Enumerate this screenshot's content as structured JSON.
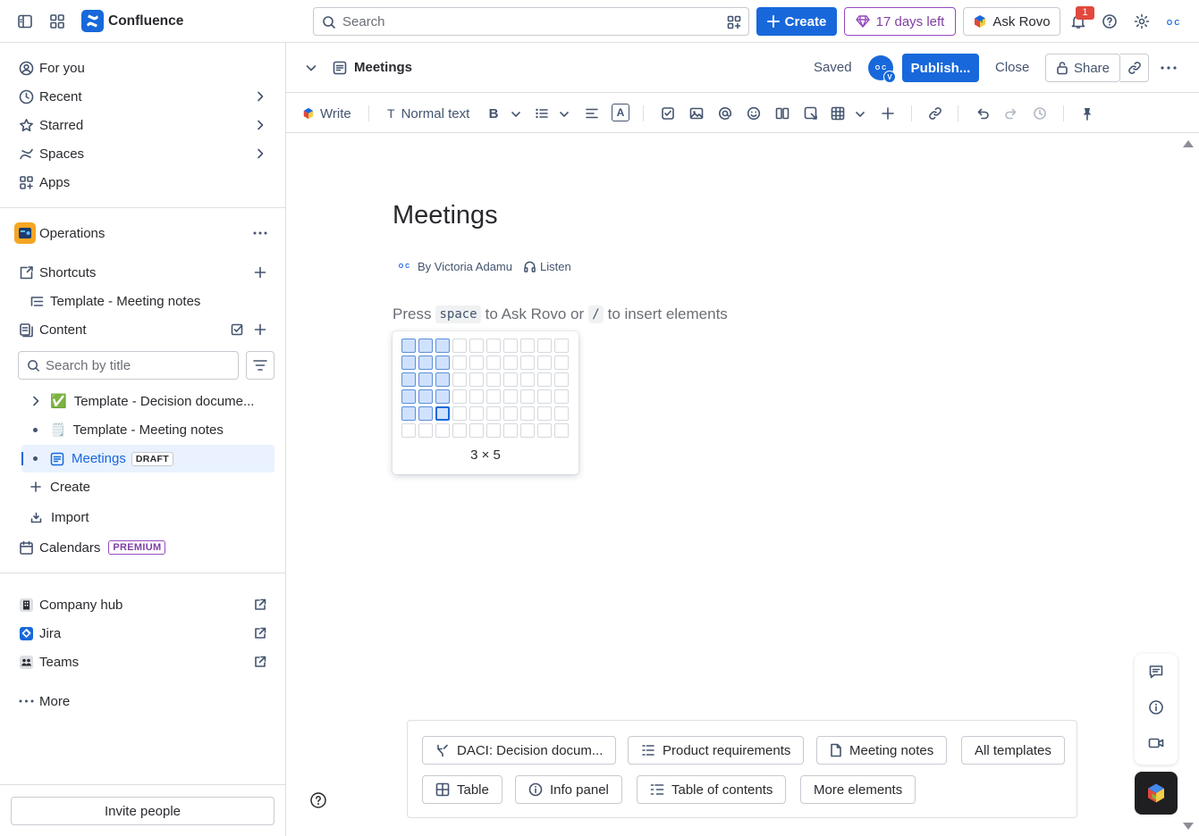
{
  "topbar": {
    "app_name": "Confluence",
    "search_placeholder": "Search",
    "create_label": "Create",
    "trial_label": "17 days left",
    "rovo_label": "Ask Rovo",
    "notifications_count": "1",
    "profile_initials": "O C"
  },
  "sidebar": {
    "nav": [
      {
        "label": "For you"
      },
      {
        "label": "Recent"
      },
      {
        "label": "Starred"
      },
      {
        "label": "Spaces"
      },
      {
        "label": "Apps"
      }
    ],
    "space_name": "Operations",
    "shortcuts_label": "Shortcuts",
    "shortcut_item": "Template - Meeting notes",
    "content_label": "Content",
    "search_placeholder": "Search by title",
    "tree": [
      {
        "label": "Template - Decision docume...",
        "emoji": "✅"
      },
      {
        "label": "Template - Meeting notes",
        "emoji": "🗒️"
      },
      {
        "label": "Meetings",
        "badge": "DRAFT"
      }
    ],
    "create_label": "Create",
    "import_label": "Import",
    "calendars_label": "Calendars",
    "calendars_badge": "PREMIUM",
    "links": [
      {
        "label": "Company hub"
      },
      {
        "label": "Jira"
      },
      {
        "label": "Teams"
      }
    ],
    "more_label": "More",
    "invite_label": "Invite people"
  },
  "page_header": {
    "title": "Meetings",
    "status": "Saved",
    "avatar_initials": "O C",
    "avatar_badge": "V",
    "publish_label": "Publish...",
    "close_label": "Close",
    "share_label": "Share"
  },
  "toolbar": {
    "write_label": "Write",
    "text_style": "Normal text",
    "text_color_glyph": "A"
  },
  "editor": {
    "title": "Meetings",
    "byline_initials": "O C",
    "author": "By Victoria Adamu",
    "listen_label": "Listen",
    "hint_press": "Press",
    "hint_key1": "space",
    "hint_middle": "to Ask Rovo or",
    "hint_key2": "/",
    "hint_end": "to insert elements"
  },
  "table_picker": {
    "columns": 10,
    "rows": 6,
    "selected_columns": 3,
    "selected_rows": 5,
    "size_label": "3 × 5"
  },
  "templates": [
    {
      "label": "DACI: Decision docum...",
      "icon": "daci-icon"
    },
    {
      "label": "Product requirements",
      "icon": "list-icon"
    },
    {
      "label": "Meeting notes",
      "icon": "document-icon"
    },
    {
      "label": "All templates",
      "icon": ""
    },
    {
      "label": "Table",
      "icon": "table-icon"
    },
    {
      "label": "Info panel",
      "icon": "info-icon"
    },
    {
      "label": "Table of contents",
      "icon": "toc-icon"
    },
    {
      "label": "More elements",
      "icon": ""
    }
  ]
}
